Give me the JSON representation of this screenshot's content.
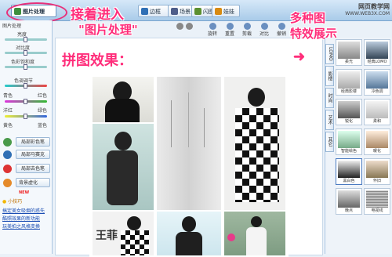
{
  "top_tabs": [
    {
      "label": "图片处理",
      "active": true,
      "color": "#3d8f3d"
    },
    {
      "label": "边框",
      "color": "#2f6fb5"
    },
    {
      "label": "场景",
      "color": "#4d5d8a"
    },
    {
      "label": "闪图",
      "color": "#5b8f2f"
    },
    {
      "label": "娃娃",
      "color": "#d88a10"
    }
  ],
  "annotations": {
    "enter": "接着进入",
    "quote": "\"图片处理\"",
    "collage": "拼图效果：",
    "effects_l1": "多种图",
    "effects_l2": "特效展示"
  },
  "watermark": {
    "line1": "网页教学网",
    "line2": "WWW.WEB3X.COM"
  },
  "left_panel": {
    "header": "图片处理",
    "adjust": [
      "亮度",
      "对比度",
      "色彩饱和度"
    ],
    "color_adjust_title": "色调调节",
    "pairs": [
      {
        "left": "青色",
        "right": "红色"
      },
      {
        "left": "洋红",
        "right": "绿色"
      },
      {
        "left": "黄色",
        "right": "蓝色"
      }
    ],
    "buttons": [
      "局部彩色笔",
      "局部马赛克",
      "局部去色笔",
      "背景虚化"
    ],
    "new_badge": "NEW",
    "tips_title": "小技巧",
    "links": [
      "搞定美女吸烟的惑先",
      "酷照效果的新功能",
      "玩美拍之风格变换"
    ]
  },
  "toolbar": [
    "旋转",
    "重置",
    "剪裁",
    "对比",
    "撤销"
  ],
  "right_panel": {
    "vertical_tabs": [
      "LOMO",
      "影楼",
      "时尚",
      "艺术",
      "其它"
    ],
    "effects": [
      "柔光",
      "经典LOMO",
      "经典影楼",
      "冷色调",
      "锐化",
      "柔和",
      "智能绘色",
      "暖化",
      "黑白色",
      "怀旧",
      "晚点",
      "电视线"
    ]
  }
}
